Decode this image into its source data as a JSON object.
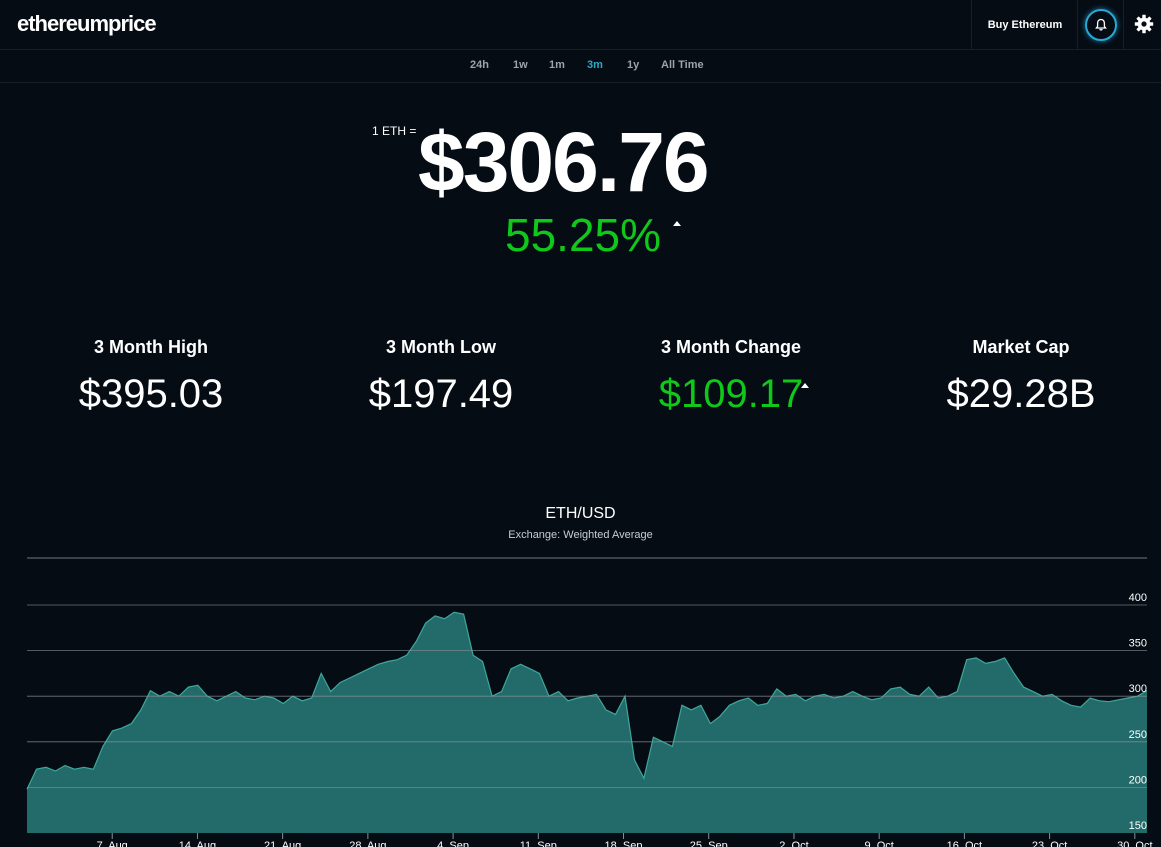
{
  "header": {
    "logo": "ethereumprice",
    "buy_label": "Buy Ethereum",
    "icons": [
      "bell-icon",
      "gear-icon"
    ]
  },
  "ranges": [
    {
      "label": "24h",
      "active": false
    },
    {
      "label": "1w",
      "active": false
    },
    {
      "label": "1m",
      "active": false
    },
    {
      "label": "3m",
      "active": true
    },
    {
      "label": "1y",
      "active": false
    },
    {
      "label": "All Time",
      "active": false
    }
  ],
  "price": {
    "prefix": "1 ETH =",
    "value": "$306.76",
    "change": "55.25%"
  },
  "stats": [
    {
      "label": "3 Month High",
      "value": "$395.03",
      "green": false
    },
    {
      "label": "3 Month Low",
      "value": "$197.49",
      "green": false
    },
    {
      "label": "3 Month Change",
      "value": "$109.17",
      "green": true
    },
    {
      "label": "Market Cap",
      "value": "$29.28B",
      "green": false
    }
  ],
  "colors": {
    "accent": "#2aa8c8",
    "green": "#10c81a",
    "area_fill": "#236b6b",
    "area_line": "#3da89a"
  },
  "chart_data": {
    "type": "area",
    "title": "ETH/USD",
    "subtitle": "Exchange: Weighted Average",
    "ylim": [
      150,
      400
    ],
    "yticks": [
      150,
      200,
      250,
      300,
      350,
      400
    ],
    "xticks": [
      "7. Aug",
      "14. Aug",
      "21. Aug",
      "28. Aug",
      "4. Sep",
      "11. Sep",
      "18. Sep",
      "25. Sep",
      "2. Oct",
      "9. Oct",
      "16. Oct",
      "23. Oct",
      "30. Oct"
    ],
    "grid": true,
    "x_start": "2017-07-31",
    "x_end": "2017-10-31",
    "values": [
      198,
      220,
      222,
      218,
      224,
      220,
      222,
      220,
      245,
      262,
      265,
      270,
      285,
      306,
      300,
      305,
      300,
      310,
      312,
      300,
      295,
      300,
      305,
      298,
      296,
      300,
      298,
      292,
      300,
      295,
      298,
      325,
      305,
      315,
      320,
      325,
      330,
      335,
      338,
      340,
      345,
      360,
      380,
      388,
      385,
      392,
      390,
      345,
      338,
      300,
      305,
      330,
      335,
      330,
      325,
      300,
      305,
      295,
      298,
      300,
      302,
      285,
      280,
      300,
      230,
      210,
      255,
      250,
      245,
      290,
      285,
      290,
      270,
      278,
      290,
      295,
      298,
      290,
      292,
      308,
      300,
      302,
      295,
      300,
      302,
      298,
      300,
      305,
      300,
      296,
      298,
      308,
      310,
      302,
      300,
      310,
      298,
      300,
      305,
      340,
      342,
      336,
      338,
      342,
      325,
      310,
      305,
      300,
      302,
      295,
      290,
      288,
      298,
      295,
      294,
      296,
      298,
      300,
      306
    ]
  }
}
